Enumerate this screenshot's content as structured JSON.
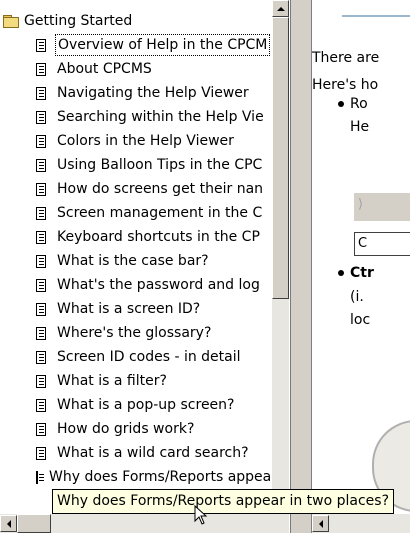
{
  "tree": {
    "root_label": "Getting Started",
    "selected_index": 0,
    "items": [
      "Overview of Help in the CPCM",
      "About CPCMS",
      "Navigating the Help Viewer",
      "Searching within the Help Vie",
      "Colors in the Help Viewer",
      "Using Balloon Tips in the CPC",
      "How do screens get their nan",
      "Screen management in the C",
      "Keyboard shortcuts in the CP",
      "What is the case bar?",
      "What's the password and  log",
      "What is a screen ID?",
      "Where's the glossary?",
      "Screen ID codes - in detail",
      "What is a filter?",
      "What is a pop-up screen?",
      "How do grids work?",
      "What is a wild card search?",
      "Why does Forms/Reports appear in two places?"
    ]
  },
  "tooltip": {
    "text": "Why does Forms/Reports appear in two places?"
  },
  "content": {
    "line1": "There are",
    "line2": "Here's ho",
    "bullet1_line1": "Ro",
    "bullet1_line2": "He",
    "field_value": "C",
    "bullet2_line1": "Ctr",
    "bullet2_line2": "(i.",
    "bullet2_line3": "loc"
  },
  "colors": {
    "tooltip_bg": "#ffffe1",
    "window_bg": "#d4d0c8"
  }
}
